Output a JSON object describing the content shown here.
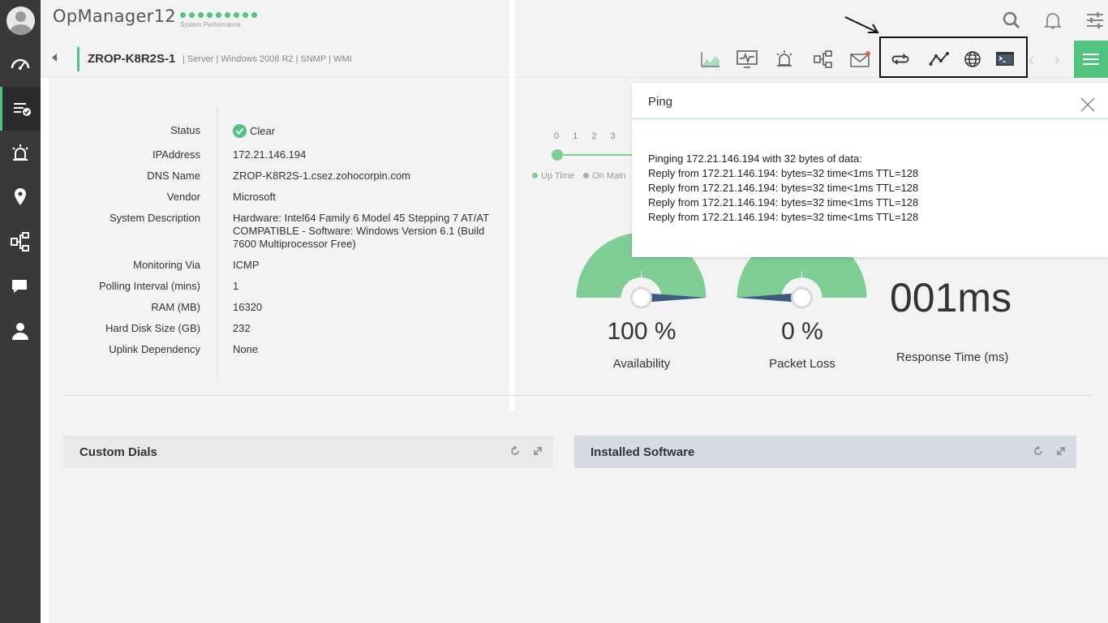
{
  "app": {
    "title": "OpManager12",
    "perf_label": "System Performance"
  },
  "device": {
    "name": "ZROP-K8R2S-1",
    "meta": "| Server | Windows 2008 R2 | SNMP | WMI"
  },
  "details": [
    {
      "label": "Status",
      "value": "Clear"
    },
    {
      "label": "IPAddress",
      "value": "172.21.146.194"
    },
    {
      "label": "DNS Name",
      "value": "ZROP-K8R2S-1.csez.zohocorpin.com"
    },
    {
      "label": "Vendor",
      "value": "Microsoft"
    },
    {
      "label": "System Description",
      "value": "Hardware: Intel64 Family 6 Model 45 Stepping 7 AT/AT COMPATIBLE - Software: Windows Version 6.1 (Build 7600 Multiprocessor Free)"
    },
    {
      "label": "Monitoring Via",
      "value": "ICMP"
    },
    {
      "label": "Polling Interval (mins)",
      "value": "1"
    },
    {
      "label": "RAM (MB)",
      "value": "16320"
    },
    {
      "label": "Hard Disk Size (GB)",
      "value": "232"
    },
    {
      "label": "Uplink Dependency",
      "value": "None"
    }
  ],
  "timeline": {
    "numbers": "0 1 2 3",
    "legend_up": "Up Time",
    "legend_maint": "On Main"
  },
  "gauges": {
    "availability": {
      "value_text": "100 %",
      "label": "Availability",
      "fraction": 1.0
    },
    "packet_loss": {
      "value_text": "0 %",
      "label": "Packet Loss",
      "fraction": 0.0
    },
    "response": {
      "value_text": "001ms",
      "label": "Response Time (ms)"
    }
  },
  "widgets": {
    "custom_dials": "Custom Dials",
    "installed_software": "Installed Software"
  },
  "ping": {
    "title": "Ping",
    "output": "Pinging 172.21.146.194 with 32 bytes of data:\nReply from 172.21.146.194: bytes=32 time<1ms TTL=128\nReply from 172.21.146.194: bytes=32 time<1ms TTL=128\nReply from 172.21.146.194: bytes=32 time<1ms TTL=128\nReply from 172.21.146.194: bytes=32 time<1ms TTL=128"
  },
  "colors": {
    "accent": "#4fc37f",
    "gauge": "#7dcd95",
    "needle": "#3d5a80",
    "sidebar": "#393939"
  }
}
